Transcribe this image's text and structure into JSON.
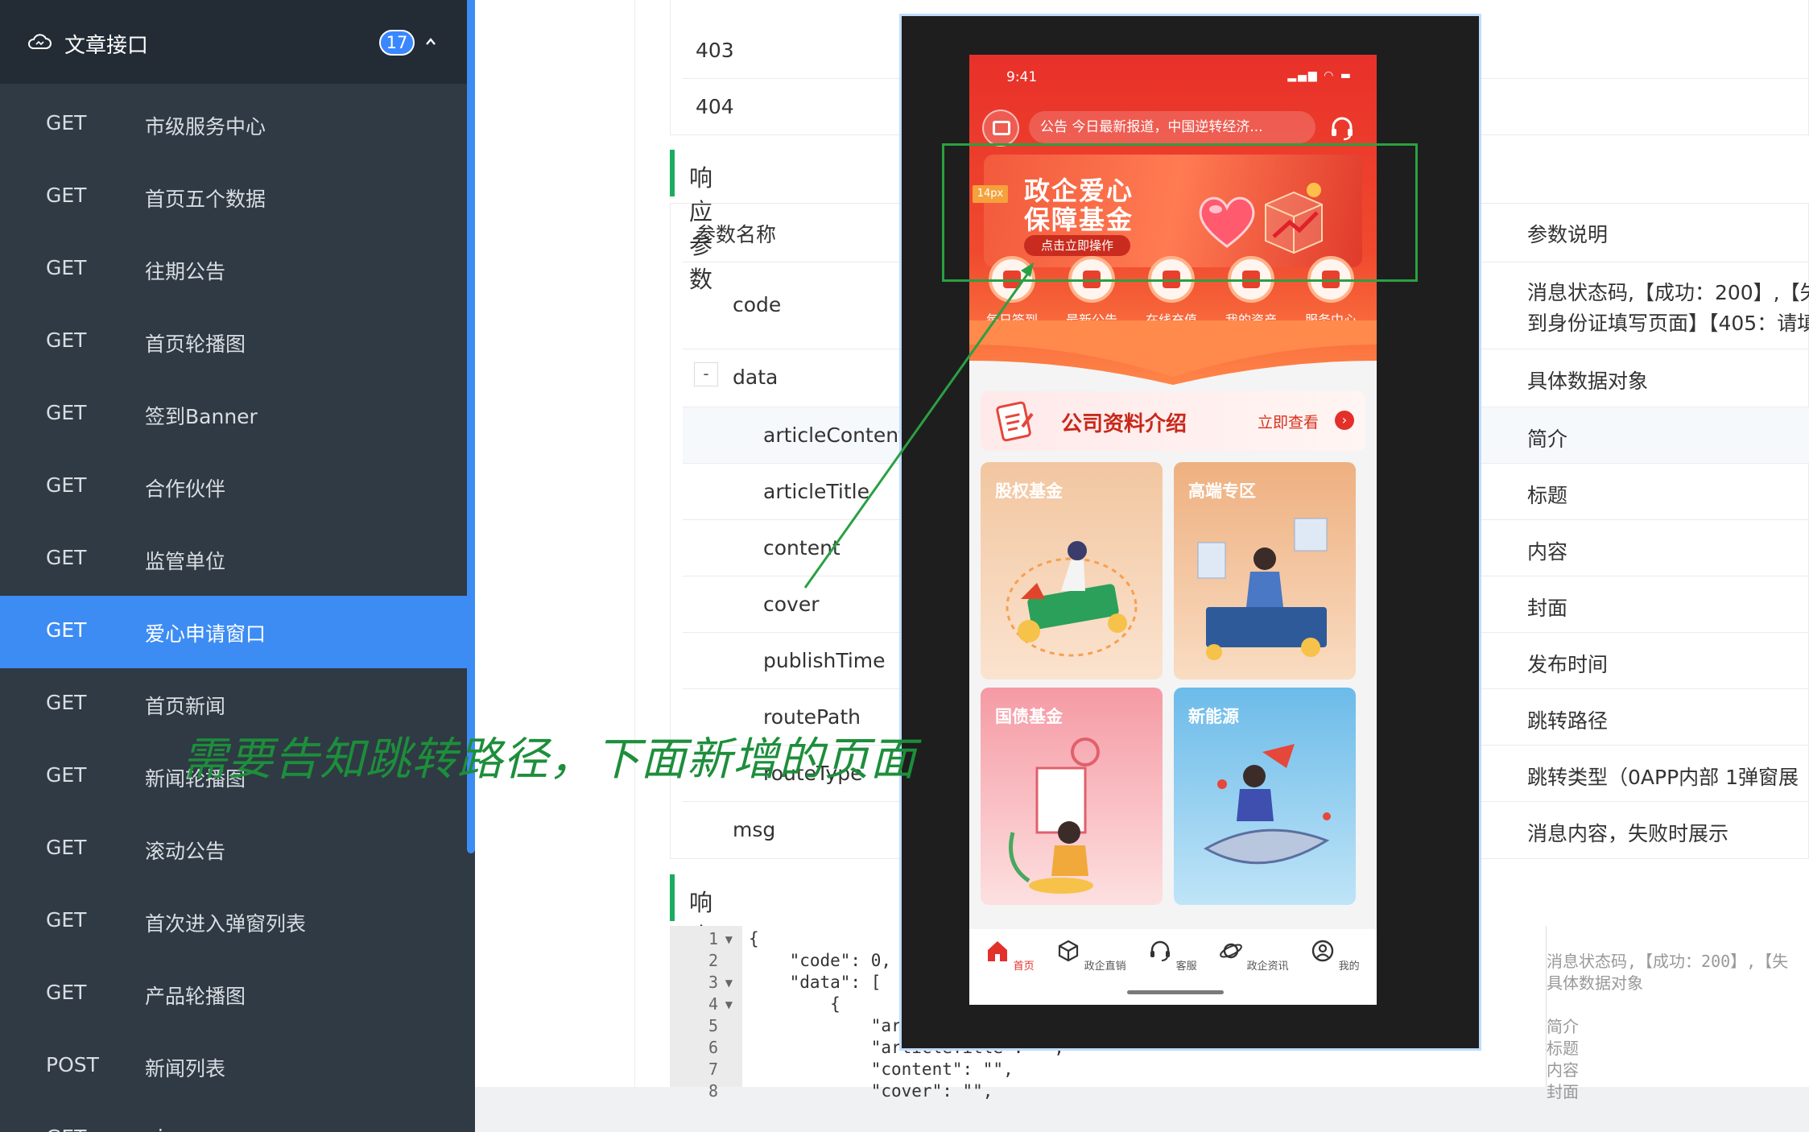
{
  "sidebar": {
    "header_title": "文章接口",
    "count_badge": "17",
    "items": [
      {
        "method": "GET",
        "name": "市级服务中心"
      },
      {
        "method": "GET",
        "name": "首页五个数据"
      },
      {
        "method": "GET",
        "name": "往期公告"
      },
      {
        "method": "GET",
        "name": "首页轮播图"
      },
      {
        "method": "GET",
        "name": "签到Banner"
      },
      {
        "method": "GET",
        "name": "合作伙伴"
      },
      {
        "method": "GET",
        "name": "监管单位"
      },
      {
        "method": "GET",
        "name": "爱心申请窗口"
      },
      {
        "method": "GET",
        "name": "首页新闻"
      },
      {
        "method": "GET",
        "name": "新闻轮播图"
      },
      {
        "method": "GET",
        "name": "滚动公告"
      },
      {
        "method": "GET",
        "name": "首次进入弹窗列表"
      },
      {
        "method": "GET",
        "name": "产品轮播图"
      },
      {
        "method": "POST",
        "name": "新闻列表"
      },
      {
        "method": "GET",
        "name": "ping"
      }
    ],
    "active_item": "爱心申请窗口"
  },
  "status_codes": [
    "403",
    "404"
  ],
  "response_params": {
    "section_title": "响应参数",
    "col_name": "参数名称",
    "col_desc": "参数说明",
    "collapse_symbol": "-",
    "rows": [
      {
        "name": "code",
        "desc": "消息状态码,【成功：200】,【失",
        "desc2": "到身份证填写页面】【405：请填"
      },
      {
        "name": "data",
        "desc": "具体数据对象"
      },
      {
        "name": "articleContent",
        "desc": "简介"
      },
      {
        "name": "articleTitle",
        "desc": "标题"
      },
      {
        "name": "content",
        "desc": "内容"
      },
      {
        "name": "cover",
        "desc": "封面"
      },
      {
        "name": "publishTime",
        "desc": "发布时间"
      },
      {
        "name": "routePath",
        "desc": "跳转路径"
      },
      {
        "name": "routeType",
        "desc": "跳转类型（0APP内部 1弹窗展"
      },
      {
        "name": "msg",
        "desc": "消息内容，失败时展示"
      }
    ]
  },
  "response_example": {
    "section_title": "响应示例",
    "line_numbers": [
      "1",
      "2",
      "3",
      "4",
      "5",
      "6",
      "7",
      "8"
    ],
    "lines": [
      "{",
      "    \"code\": 0,",
      "    \"data\": [",
      "        {",
      "            \"ar",
      "            \"articleTitle\": \"\",",
      "            \"content\": \"\",",
      "            \"cover\": \"\","
    ],
    "comments": [
      "消息状态码,【成功：200】,【失",
      "具体数据对象",
      "",
      "简介",
      "标题",
      "内容",
      "封面"
    ]
  },
  "phone": {
    "time": "9:41",
    "status_icons": "▂▄▆ ◠ ▬",
    "notice_text": "公告  今日最新报道，中国逆转经济...",
    "banner_line1": "政企爱心",
    "banner_line2": "保障基金",
    "banner_button": "点击立即操作",
    "px_tag": "14px",
    "quick_items": [
      "每日签到",
      "最新公告",
      "在线充值",
      "我的资产",
      "服务中心"
    ],
    "company_title": "公司资料介绍",
    "company_more": "立即查看",
    "company_arrow": "›",
    "cards": [
      "股权基金",
      "高端专区",
      "国债基金",
      "新能源"
    ],
    "tabs": [
      "首页",
      "政企直销",
      "客服",
      "政企资讯",
      "我的"
    ],
    "colors": {
      "primary": "#e2302a",
      "card1": "#f6c9a6",
      "card2": "#f0b48a",
      "card3": "#f6a7ae",
      "card4": "#7ec6f0"
    }
  },
  "annotation": {
    "text": "需要告知跳转路径，下面新增的页面",
    "color": "#1d8e3b"
  }
}
